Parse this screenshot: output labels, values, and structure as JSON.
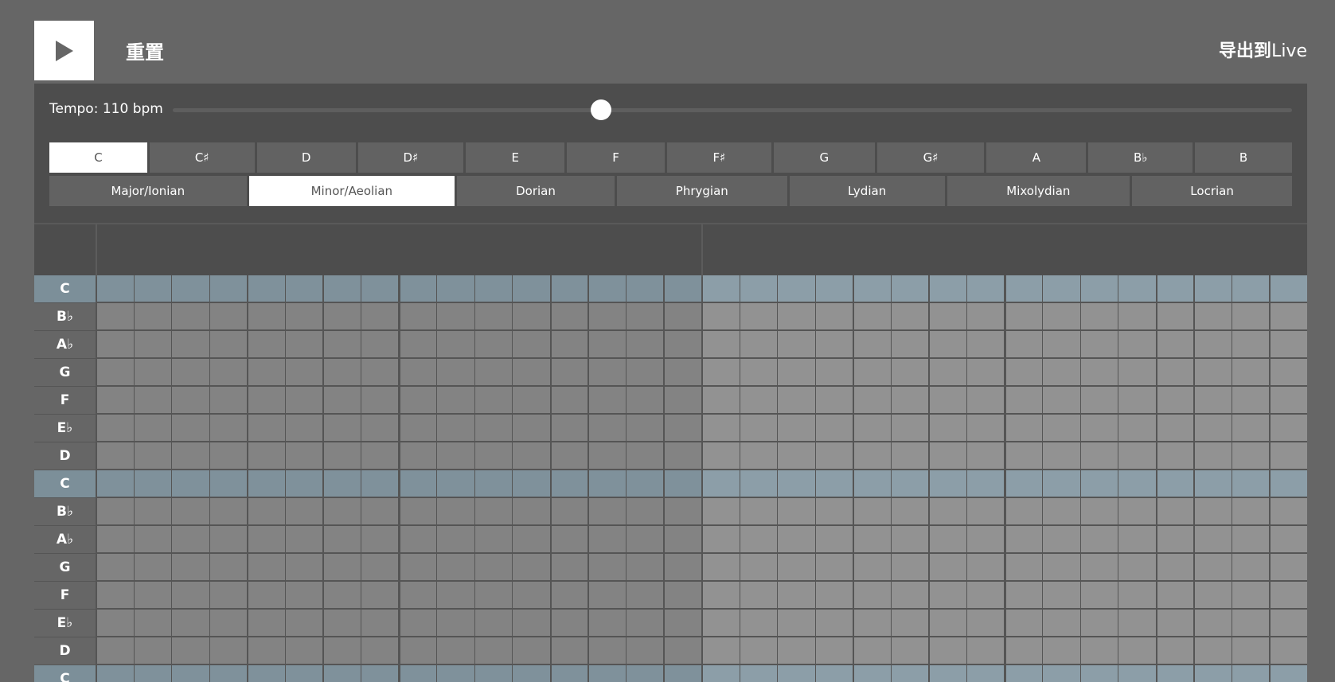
{
  "toolbar": {
    "reset_label": "重置",
    "export_label": "导出到",
    "export_suffix": "Live",
    "play_icon": "play-icon"
  },
  "tempo": {
    "label": "Tempo: 110 bpm",
    "value": 110,
    "fraction": 0.383
  },
  "keys": [
    {
      "label": "C",
      "selected": true
    },
    {
      "label": "C♯",
      "selected": false
    },
    {
      "label": "D",
      "selected": false
    },
    {
      "label": "D♯",
      "selected": false
    },
    {
      "label": "E",
      "selected": false
    },
    {
      "label": "F",
      "selected": false
    },
    {
      "label": "F♯",
      "selected": false
    },
    {
      "label": "G",
      "selected": false
    },
    {
      "label": "G♯",
      "selected": false
    },
    {
      "label": "A",
      "selected": false
    },
    {
      "label": "B♭",
      "selected": false
    },
    {
      "label": "B",
      "selected": false
    }
  ],
  "modes": [
    {
      "label": "Major/Ionian",
      "selected": false
    },
    {
      "label": "Minor/Aeolian",
      "selected": true
    },
    {
      "label": "Dorian",
      "selected": false
    },
    {
      "label": "Phrygian",
      "selected": false
    },
    {
      "label": "Lydian",
      "selected": false
    },
    {
      "label": "Mixolydian",
      "selected": false
    },
    {
      "label": "Locrian",
      "selected": false
    }
  ],
  "grid": {
    "notes": [
      {
        "label": "C",
        "tonic": true
      },
      {
        "label": "B♭",
        "tonic": false
      },
      {
        "label": "A♭",
        "tonic": false
      },
      {
        "label": "G",
        "tonic": false
      },
      {
        "label": "F",
        "tonic": false
      },
      {
        "label": "E♭",
        "tonic": false
      },
      {
        "label": "D",
        "tonic": false
      },
      {
        "label": "C",
        "tonic": true
      },
      {
        "label": "B♭",
        "tonic": false
      },
      {
        "label": "A♭",
        "tonic": false
      },
      {
        "label": "G",
        "tonic": false
      },
      {
        "label": "F",
        "tonic": false
      },
      {
        "label": "E♭",
        "tonic": false
      },
      {
        "label": "D",
        "tonic": false
      },
      {
        "label": "C",
        "tonic": true
      }
    ],
    "steps": 32,
    "measures": 2
  },
  "colors": {
    "background": "#666666",
    "panel": "#4d4d4d",
    "button": "#626262",
    "selected": "#ffffff",
    "cell_odd_measure": "#838383",
    "cell_even_measure": "#929292",
    "tonic_cell_odd_measure": "#7f919b",
    "tonic_cell_even_measure": "#8c9ea8",
    "tonic_label_bg": "#7c8f99",
    "label_bg": "#666666"
  }
}
